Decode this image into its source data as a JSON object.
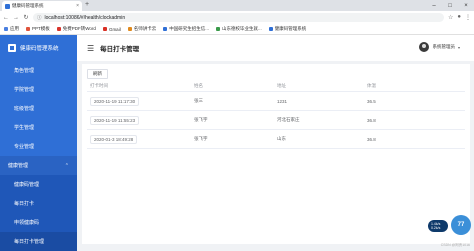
{
  "browser": {
    "tab_title": "健康码管理系统",
    "url": "localhost:10086/#/health/clockadmin",
    "info_label": "ⓘ",
    "bookmarks": [
      {
        "label": "应用",
        "color": "#4a7fe0"
      },
      {
        "label": "PPT模板",
        "color": "#e0533b"
      },
      {
        "label": "免费PDF转Word",
        "color": "#d9342b"
      },
      {
        "label": "Gmail",
        "color": "#d93025"
      },
      {
        "label": "名师讲卡云",
        "color": "#e08a1e"
      },
      {
        "label": "中国研究生招生信...",
        "color": "#2f6fd6"
      },
      {
        "label": "山东德校毕业生就...",
        "color": "#3a9a4a"
      },
      {
        "label": "健康码管理系统",
        "color": "#2f6fd6"
      }
    ]
  },
  "sidebar": {
    "brand": "健康码管理系统",
    "items": [
      "角色管理",
      "学院管理",
      "班级管理",
      "学生管理",
      "专业管理"
    ],
    "group": "健康管理",
    "sub_items": [
      "健康码管理",
      "每日打卡",
      "申领健康码",
      "每日打卡管理"
    ],
    "active_index": 3
  },
  "header": {
    "title": "每日打卡管理",
    "user": "系统管理员"
  },
  "content": {
    "button_label": "刷新",
    "columns": [
      "打卡时间",
      "姓名",
      "地址",
      "体温"
    ],
    "rows": [
      [
        "2020-11-19 11:17:30",
        "张三",
        "1231",
        "36.5"
      ],
      [
        "2020-11-19 11:55:23",
        "张飞宇",
        "河北石家庄",
        "36.8"
      ],
      [
        "2020-01-3 18:49:28",
        "张飞宇",
        "山东",
        "36.8"
      ]
    ]
  },
  "overlay": {
    "speed_up": "1.4k/s",
    "speed_down": "0.2k/s",
    "badge": "77",
    "watermark": "CSDN @阿贵1016"
  }
}
